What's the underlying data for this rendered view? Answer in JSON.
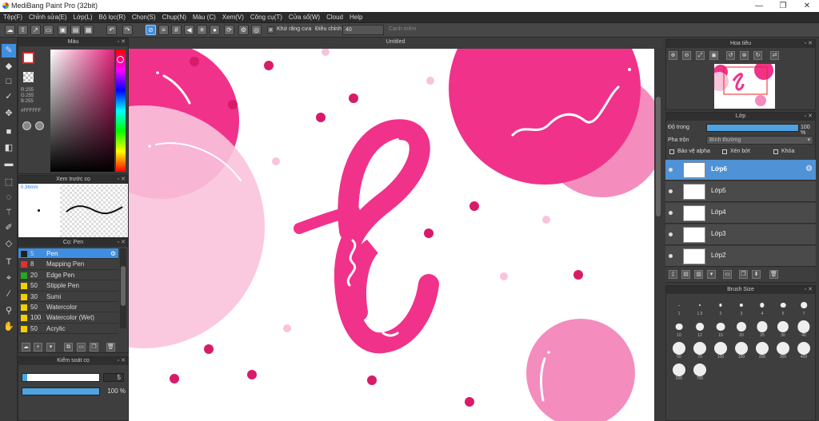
{
  "titlebar": {
    "title": "MediBang Paint Pro (32bit)",
    "minimize": "—",
    "maximize": "❐",
    "close": "✕"
  },
  "menu": [
    "Tệp(F)",
    "Chỉnh sửa(E)",
    "Lớp(L)",
    "Bộ lọc(R)",
    "Chọn(S)",
    "Chụp(N)",
    "Màu (C)",
    "Xem(V)",
    "Công cụ(T)",
    "Cửa sổ(W)",
    "Cloud",
    "Help"
  ],
  "toolbar": {
    "antialias_label": "Khử răng cưa",
    "adjust_label": "Điều chỉnh",
    "adjust_value": "40",
    "correction_label": "Canh mềm"
  },
  "panels": {
    "color": {
      "title": "Màu",
      "r": "R:255",
      "g": "G:255",
      "b": "B:255",
      "hex": "#FFFFFF",
      "fg_color": "#ffffff",
      "bg_color": "#ffffff"
    },
    "preview": {
      "title": "Xem trước cọ",
      "size_label": "0.36mm"
    },
    "brush": {
      "title": "Cọ: Pen",
      "items": [
        {
          "color": "#222222",
          "size": "5",
          "name": "Pen",
          "selected": true
        },
        {
          "color": "#e03030",
          "size": "8",
          "name": "Mapping Pen",
          "selected": false
        },
        {
          "color": "#22aa22",
          "size": "20",
          "name": "Edge Pen",
          "selected": false
        },
        {
          "color": "#f0d000",
          "size": "50",
          "name": "Stipple Pen",
          "selected": false
        },
        {
          "color": "#f0d000",
          "size": "30",
          "name": "Sumi",
          "selected": false
        },
        {
          "color": "#f0d000",
          "size": "50",
          "name": "Watercolor",
          "selected": false
        },
        {
          "color": "#f0d000",
          "size": "100",
          "name": "Watercolor (Wet)",
          "selected": false
        },
        {
          "color": "#f0d000",
          "size": "50",
          "name": "Acrylic",
          "selected": false
        }
      ]
    },
    "brush_control": {
      "title": "Kiểm soát cọ",
      "size_value": "5",
      "opacity_value": "100 %",
      "opacity_fraction": 1.0
    }
  },
  "document": {
    "tab_title": "Untitled"
  },
  "right": {
    "navigator": {
      "title": "Hoa tiêu"
    },
    "layer": {
      "title": "Lớp",
      "opacity_label": "Độ trong",
      "opacity_value": "100 %",
      "opacity_fraction": 1.0,
      "blend_label": "Pha trộn",
      "blend_value": "Bình thường",
      "protect_alpha": "Bảo vệ alpha",
      "clipping": "Xén bớt",
      "lock": "Khóa",
      "layers": [
        {
          "name": "Lớp6",
          "selected": true
        },
        {
          "name": "Lớp5",
          "selected": false
        },
        {
          "name": "Lớp4",
          "selected": false
        },
        {
          "name": "Lớp3",
          "selected": false
        },
        {
          "name": "Lớp2",
          "selected": false
        }
      ]
    },
    "brush_size": {
      "title": "Brush Size",
      "labels": [
        "1",
        "1.5",
        "2",
        "3",
        "4",
        "5",
        "7",
        "10",
        "12",
        "15",
        "20",
        "25",
        "30",
        "40",
        "50",
        "70",
        "100",
        "150",
        "200",
        "300",
        "400",
        "500",
        "700"
      ]
    }
  },
  "colors": {
    "accent": "#3f8ee0",
    "pink": "#f0328a",
    "pink_light": "#f9c3dc",
    "pink_mid": "#f48cbd",
    "dot": "#d81b68"
  }
}
